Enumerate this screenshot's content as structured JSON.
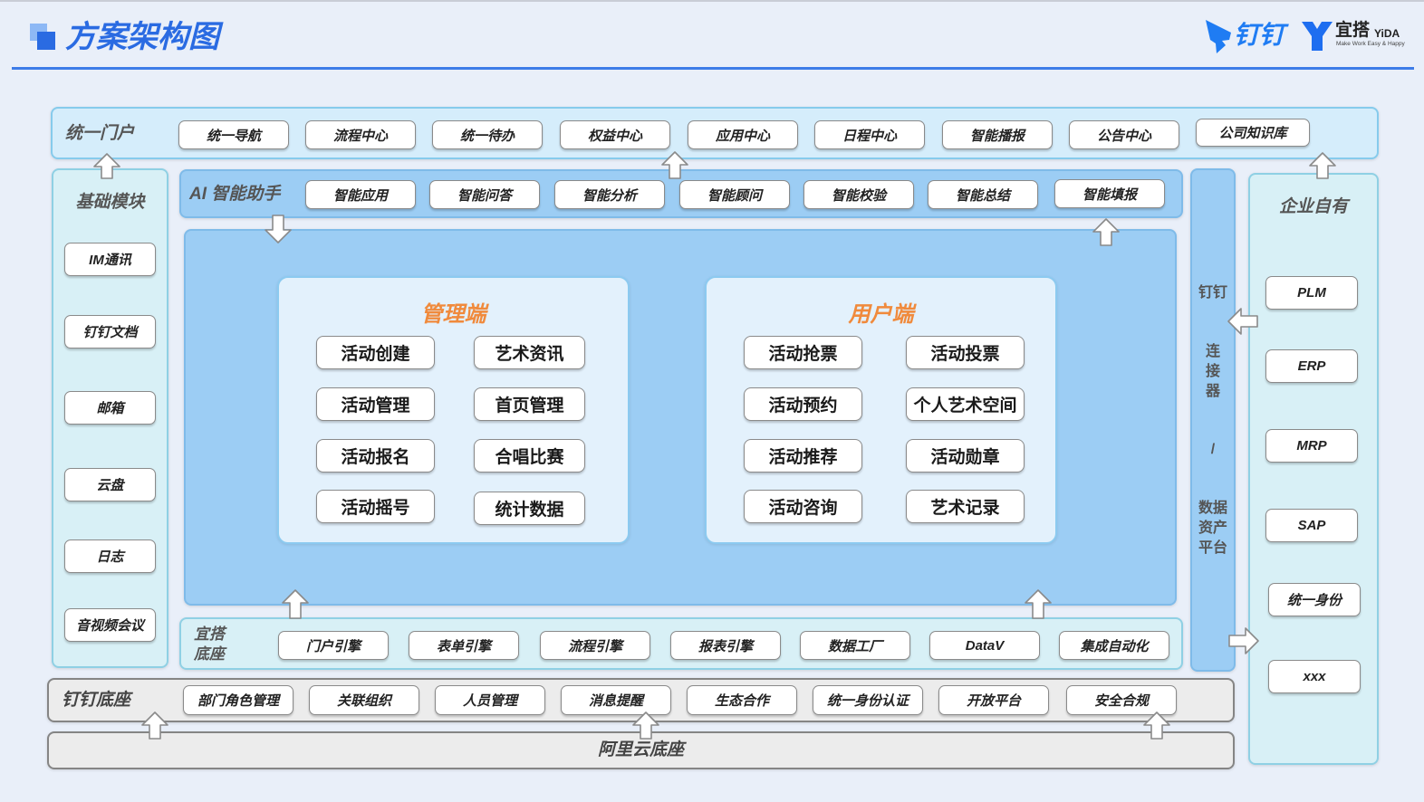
{
  "header": {
    "title": "方案架构图"
  },
  "logos": {
    "dingtalk": "钉钉",
    "yida": "宜搭",
    "yida_latin": "YiDA",
    "yida_tagline": "Make Work Easy & Happy"
  },
  "portal": {
    "label": "统一门户",
    "items": [
      "统一导航",
      "流程中心",
      "统一待办",
      "权益中心",
      "应用中心",
      "日程中心",
      "智能播报",
      "公告中心",
      "公司知识库"
    ]
  },
  "base_modules": {
    "label": "基础模块",
    "items": [
      "IM通讯",
      "钉钉文档",
      "邮箱",
      "云盘",
      "日志",
      "音视频会议"
    ]
  },
  "ai_assistant": {
    "label": "AI 智能助手",
    "items": [
      "智能应用",
      "智能问答",
      "智能分析",
      "智能顾问",
      "智能校验",
      "智能总结",
      "智能填报"
    ]
  },
  "admin_side": {
    "title": "管理端",
    "items": [
      "活动创建",
      "艺术资讯",
      "活动管理",
      "首页管理",
      "活动报名",
      "合唱比赛",
      "活动摇号",
      "统计数据"
    ]
  },
  "user_side": {
    "title": "用户端",
    "items": [
      "活动抢票",
      "活动投票",
      "活动预约",
      "个人艺术空间",
      "活动推荐",
      "活动勋章",
      "活动咨询",
      "艺术记录"
    ]
  },
  "yida_base": {
    "label_lines": [
      "宜搭",
      "底座"
    ],
    "items": [
      "门户引擎",
      "表单引擎",
      "流程引擎",
      "报表引擎",
      "数据工厂",
      "DataV",
      "集成自动化"
    ]
  },
  "connector": {
    "lines": [
      "钉钉",
      "连",
      "接",
      "器",
      "/",
      "数据",
      "资产",
      "平台"
    ]
  },
  "enterprise": {
    "label": "企业自有",
    "items": [
      "PLM",
      "ERP",
      "MRP",
      "SAP",
      "统一身份",
      "xxx"
    ]
  },
  "dingtalk_base": {
    "label": "钉钉底座",
    "items": [
      "部门角色管理",
      "关联组织",
      "人员管理",
      "消息提醒",
      "生态合作",
      "统一身份认证",
      "开放平台",
      "安全合规"
    ]
  },
  "aliyun_base": {
    "label": "阿里云底座"
  },
  "icons": {
    "header": "stacked-squares-icon",
    "dingtalk_logo": "dingtalk-bird-icon",
    "yida_logo": "yida-y-icon",
    "flow": "hollow-arrow-icon"
  },
  "colors": {
    "page_background": "#e9eff9",
    "title_blue": "#2a6be2",
    "divider_blue": "#3d7ce8",
    "panel_title_orange": "#f08a3c",
    "portal_zone": "#d5edfb",
    "light_blue_zone": "#9ccdf4",
    "light_cyan_zone": "#d8f0f6",
    "panel_fill": "#e3f1fc",
    "gray_zone": "#ececec",
    "node_fill": "#ffffff",
    "node_border": "#8a8a8a",
    "label_gray": "#555555",
    "dingtalk_blue": "#1f7cf3",
    "yida_blue": "#1e6ef0"
  }
}
